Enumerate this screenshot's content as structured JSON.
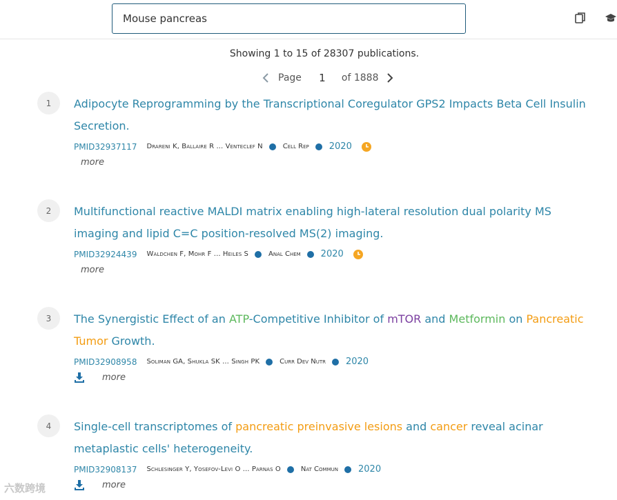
{
  "search": {
    "value": "Mouse pancreas"
  },
  "summary": "Showing 1 to 15 of 28307 publications.",
  "pager": {
    "page_label": "Page",
    "page": "1",
    "of_label": "of 1888"
  },
  "colors": {
    "link": "#2e86a8",
    "orange": "#f39c12",
    "green": "#5cb85c",
    "purple": "#7b3fa0",
    "dot": "#1f6fa6",
    "clock": "#f5a623"
  },
  "results": [
    {
      "index": "1",
      "title_parts": [
        {
          "text": "Adipocyte Reprogramming by the Transcriptional Coregulator GPS2 Impacts Beta Cell Insulin Secretion.",
          "color": ""
        }
      ],
      "pmid": "PMID32937117",
      "authors": "Drareni K, Ballaire R ... Venteclef N",
      "journal": "Cell Rep",
      "year": "2020",
      "has_clock": true,
      "has_download": false,
      "more": "more"
    },
    {
      "index": "2",
      "title_parts": [
        {
          "text": "Multifunctional reactive MALDI matrix enabling high-lateral resolution dual polarity MS imaging and lipid C=C position-resolved MS(2) imaging.",
          "color": ""
        }
      ],
      "pmid": "PMID32924439",
      "authors": "Waldchen F, Mohr F ... Heiles S",
      "journal": "Anal Chem",
      "year": "2020",
      "has_clock": true,
      "has_download": false,
      "more": "more"
    },
    {
      "index": "3",
      "title_parts": [
        {
          "text": "The Synergistic Effect of an ",
          "color": ""
        },
        {
          "text": "ATP",
          "color": "green"
        },
        {
          "text": "-Competitive Inhibitor of ",
          "color": ""
        },
        {
          "text": "mTOR",
          "color": "purple"
        },
        {
          "text": " and ",
          "color": ""
        },
        {
          "text": "Metformin",
          "color": "green"
        },
        {
          "text": " on ",
          "color": ""
        },
        {
          "text": "Pancreatic Tumor",
          "color": "orange"
        },
        {
          "text": " Growth.",
          "color": ""
        }
      ],
      "pmid": "PMID32908958",
      "authors": "Soliman GA, Shukla SK ... Singh PK",
      "journal": "Curr Dev Nutr",
      "year": "2020",
      "has_clock": false,
      "has_download": true,
      "more": "more"
    },
    {
      "index": "4",
      "title_parts": [
        {
          "text": "Single-cell transcriptomes of ",
          "color": ""
        },
        {
          "text": "pancreatic preinvasive lesions",
          "color": "orange"
        },
        {
          "text": " and ",
          "color": ""
        },
        {
          "text": "cancer",
          "color": "orange"
        },
        {
          "text": " reveal acinar metaplastic cells' heterogeneity.",
          "color": ""
        }
      ],
      "pmid": "PMID32908137",
      "authors": "Schlesinger Y, Yosefov-Levi O ... Parnas O",
      "journal": "Nat Commun",
      "year": "2020",
      "has_clock": false,
      "has_download": true,
      "more": "more"
    }
  ],
  "watermark": "六数跨境"
}
